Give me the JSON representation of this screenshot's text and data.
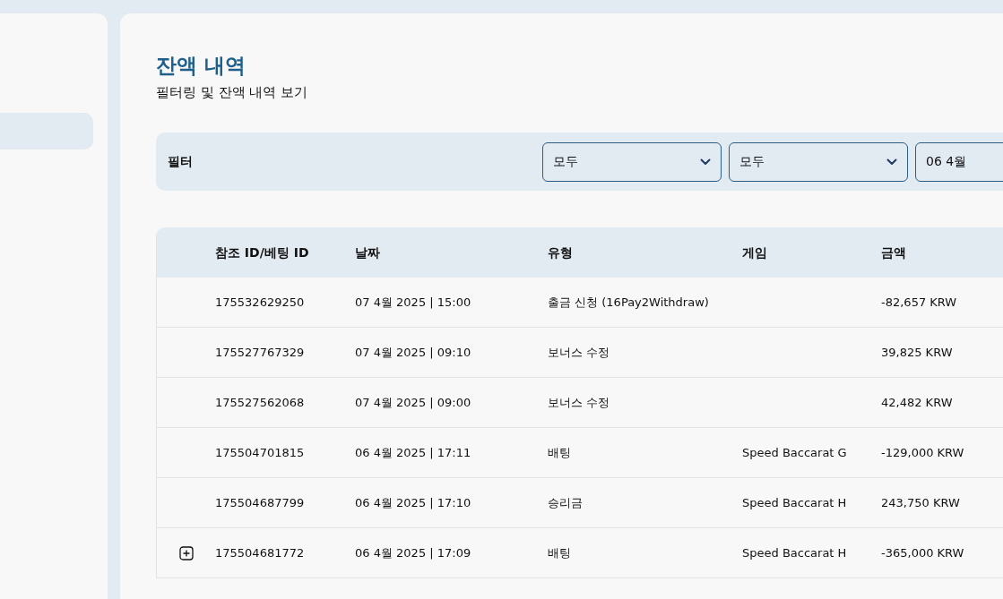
{
  "page": {
    "title": "잔액 내역",
    "subtitle": "필터링 및 잔액 내역 보기"
  },
  "sidebar": {
    "items": [
      {
        "selected": true
      }
    ]
  },
  "filter": {
    "label": "필터",
    "selects": [
      {
        "kind": "select",
        "value": "모두"
      },
      {
        "kind": "select",
        "value": "모두"
      },
      {
        "kind": "date",
        "value": "06 4월"
      }
    ]
  },
  "table": {
    "columns": [
      "참조 ID/베팅 ID",
      "날짜",
      "유형",
      "게임",
      "금액"
    ],
    "rows": [
      {
        "expandable": false,
        "cells": [
          "175532629250",
          "07 4월 2025 | 15:00",
          "출금 신청 (16Pay2Withdraw)",
          "",
          "-82,657 KRW"
        ]
      },
      {
        "expandable": false,
        "cells": [
          "175527767329",
          "07 4월 2025 | 09:10",
          "보너스 수정",
          "",
          "39,825 KRW"
        ]
      },
      {
        "expandable": false,
        "cells": [
          "175527562068",
          "07 4월 2025 | 09:00",
          "보너스 수정",
          "",
          "42,482 KRW"
        ]
      },
      {
        "expandable": false,
        "cells": [
          "175504701815",
          "06 4월 2025 | 17:11",
          "배팅",
          "Speed Baccarat G",
          "-129,000 KRW"
        ]
      },
      {
        "expandable": false,
        "cells": [
          "175504687799",
          "06 4월 2025 | 17:10",
          "승리금",
          "Speed Baccarat H",
          "243,750 KRW"
        ]
      },
      {
        "expandable": true,
        "cells": [
          "175504681772",
          "06 4월 2025 | 17:09",
          "배팅",
          "Speed Baccarat H",
          "-365,000 KRW"
        ]
      }
    ]
  }
}
